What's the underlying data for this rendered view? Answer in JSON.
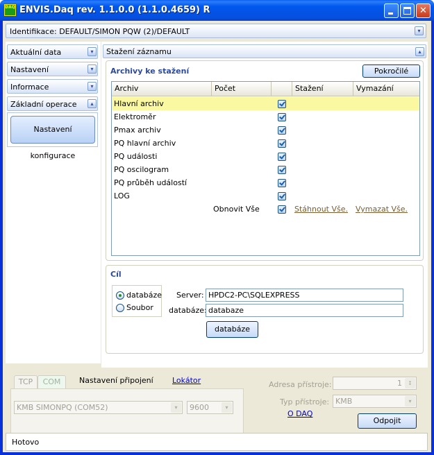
{
  "window": {
    "title": "ENVIS.Daq rev. 1.1.0.0 (1.1.0.4659) R",
    "icon_text": "DAQ",
    "controls": [
      "minimize",
      "maximize",
      "close"
    ],
    "close_glyph": "✕"
  },
  "identification": {
    "label": "Identifikace: DEFAULT/SIMON PQW (2)/DEFAULT"
  },
  "sidebar": {
    "items": [
      {
        "label": "Aktuální data",
        "chevron": "▾"
      },
      {
        "label": "Nastavení",
        "chevron": "▾"
      },
      {
        "label": "Informace",
        "chevron": "▾"
      },
      {
        "label": "Základní operace",
        "chevron": "▴"
      }
    ],
    "config_button": "Nastavení konfigurace"
  },
  "main": {
    "header": "Stažení záznamu",
    "header_chevron": "▴",
    "archives": {
      "title": "Archivy ke stažení",
      "advanced_button": "Pokročilé",
      "columns": [
        "Archiv",
        "Počet",
        "",
        "Stažení",
        "Vymazání"
      ],
      "rows": [
        {
          "name": "Hlavní archiv",
          "checked": true,
          "selected": true
        },
        {
          "name": "Elektroměr",
          "checked": true
        },
        {
          "name": "Pmax archiv",
          "checked": true
        },
        {
          "name": "PQ hlavní archiv",
          "checked": true
        },
        {
          "name": "PQ události",
          "checked": true
        },
        {
          "name": "PQ oscilogram",
          "checked": true
        },
        {
          "name": "PQ průběh událostí",
          "checked": true
        },
        {
          "name": "LOG",
          "checked": true
        }
      ],
      "footer": {
        "refresh_all": "Obnovit Vše",
        "download_all": "Stáhnout Vše.",
        "delete_all": "Vymazat Vše."
      }
    },
    "target": {
      "title": "Cíl",
      "options": [
        {
          "label": "databáze",
          "selected": true
        },
        {
          "label": "Soubor",
          "selected": false
        }
      ],
      "server_label": "Server:",
      "server_value": "HPDC2-PC\\SQLEXPRESS",
      "database_label": "databáze:",
      "database_value": "databaze",
      "database_button": "databáze"
    }
  },
  "connection": {
    "tabs": [
      "TCP",
      "COM"
    ],
    "settings_label": "Nastavení připojení",
    "locator_link": "Lokátor",
    "port_value": "KMB SIMONPQ (COM52)",
    "baud_value": "9600",
    "address_label": "Adresa přístroje:",
    "address_value": "1",
    "device_type_label": "Typ přístroje:",
    "device_type_value": "KMB",
    "about_link": "O DAQ",
    "disconnect_button": "Odpojit"
  },
  "status": {
    "text": "Hotovo"
  },
  "colors": {
    "titlebar": "#0058ee",
    "selected_row": "#fbf8a2",
    "group_title": "#2c4a9a",
    "close_button": "#c83a1c"
  }
}
